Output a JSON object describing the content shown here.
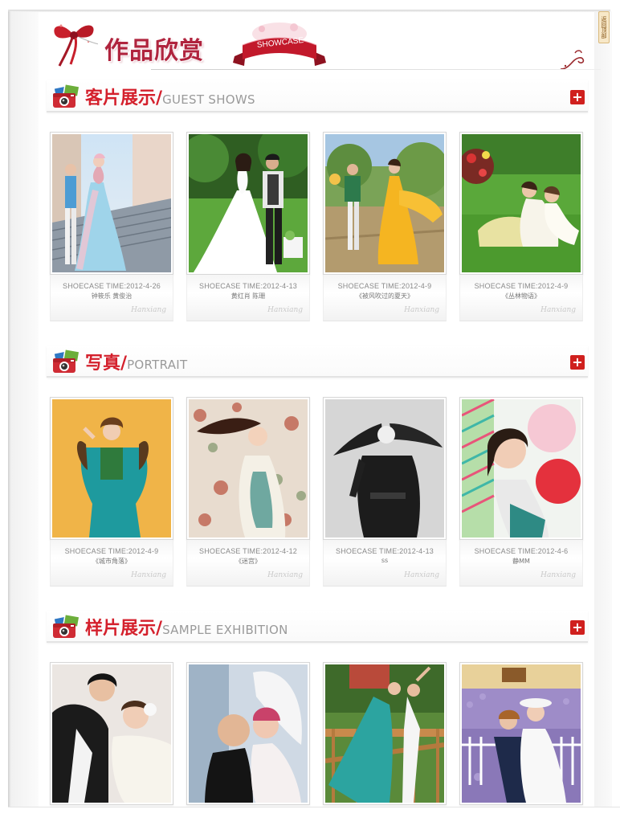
{
  "side_tab": {
    "label": "返回顶部"
  },
  "header": {
    "title": "作品欣赏",
    "badge": "SHOWCASE"
  },
  "colors": {
    "accent_red": "#d4202c",
    "title_crimson": "#b0243e",
    "gray_text": "#9a9a9a"
  },
  "sections": [
    {
      "title_cn": "客片展示",
      "title_en": "GUEST SHOWS",
      "more_label": "+",
      "items": [
        {
          "time": "SHOECASE TIME:2012-4-26",
          "name": "钟筱乐 黄俊治",
          "sign": "Hanxiang"
        },
        {
          "time": "SHOECASE TIME:2012-4-13",
          "name": "黄红肖 陈珊",
          "sign": "Hanxiang"
        },
        {
          "time": "SHOECASE TIME:2012-4-9",
          "name": "《被风吹过的夏天》",
          "sign": "Hanxiang"
        },
        {
          "time": "SHOECASE TIME:2012-4-9",
          "name": "《丛林物语》",
          "sign": "Hanxiang"
        }
      ]
    },
    {
      "title_cn": "写真",
      "title_en": "PORTRAIT",
      "more_label": "+",
      "items": [
        {
          "time": "SHOECASE TIME:2012-4-9",
          "name": "《城市角落》",
          "sign": "Hanxiang"
        },
        {
          "time": "SHOECASE TIME:2012-4-12",
          "name": "《迷宫》",
          "sign": "Hanxiang"
        },
        {
          "time": "SHOECASE TIME:2012-4-13",
          "name": "ss",
          "sign": "Hanxiang"
        },
        {
          "time": "SHOECASE TIME:2012-4-6",
          "name": "静MM",
          "sign": "Hanxiang"
        }
      ]
    },
    {
      "title_cn": "样片展示",
      "title_en": "SAMPLE EXHIBITION",
      "more_label": "+"
    }
  ]
}
